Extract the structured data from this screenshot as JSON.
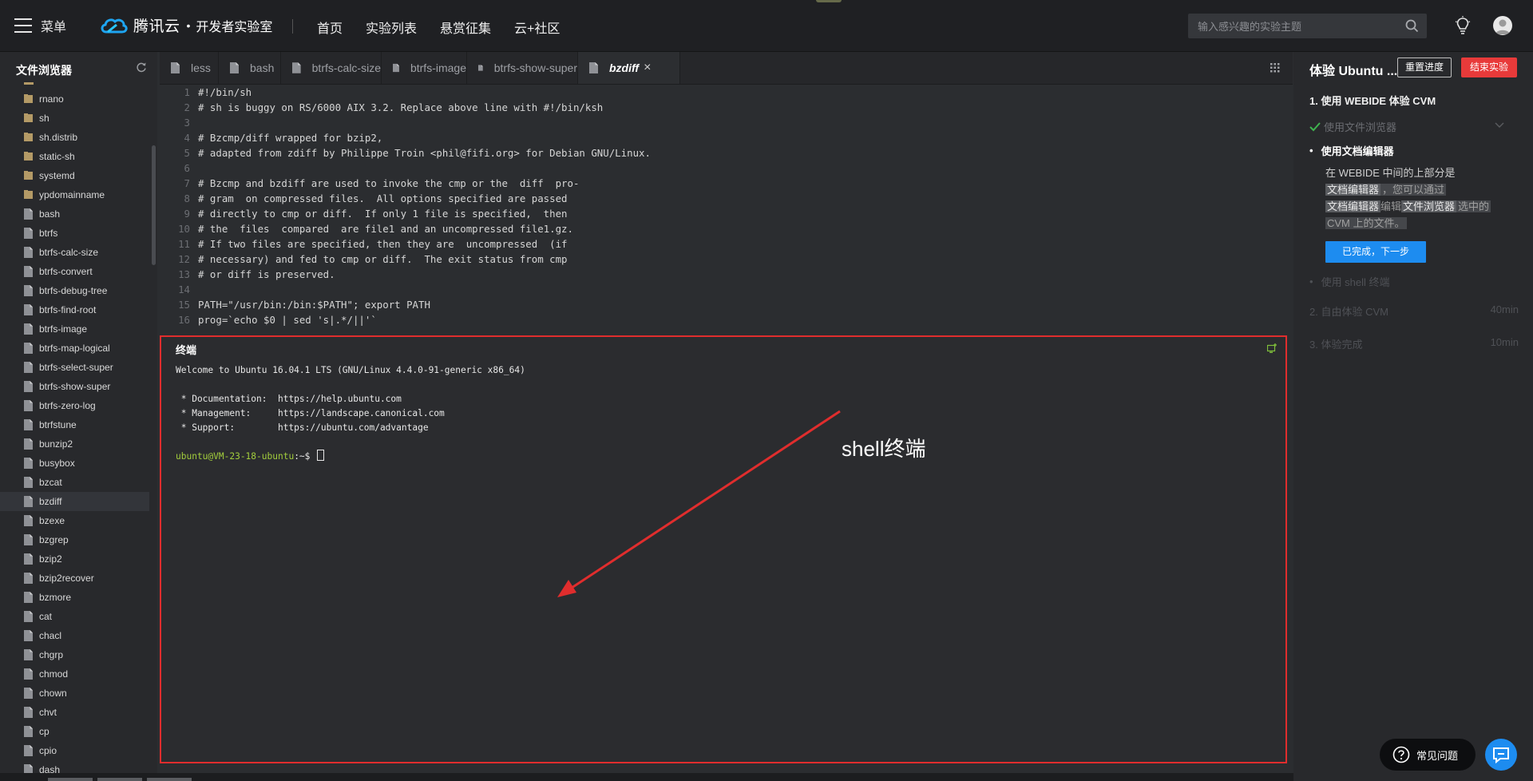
{
  "topbar": {
    "menu_label": "菜单",
    "brand": "腾讯云",
    "brand_dot": "•",
    "brand_sub": "开发者实验室",
    "nav": [
      "首页",
      "实验列表",
      "悬赏征集",
      "云+社区"
    ],
    "search_placeholder": "输入感兴趣的实验主题"
  },
  "explorer": {
    "title": "文件浏览器",
    "items": [
      {
        "name": "rnano",
        "type": "folder"
      },
      {
        "name": "sh",
        "type": "folder"
      },
      {
        "name": "sh.distrib",
        "type": "folder"
      },
      {
        "name": "static-sh",
        "type": "folder"
      },
      {
        "name": "systemd",
        "type": "folder"
      },
      {
        "name": "ypdomainname",
        "type": "folder"
      },
      {
        "name": "bash",
        "type": "file"
      },
      {
        "name": "btrfs",
        "type": "file"
      },
      {
        "name": "btrfs-calc-size",
        "type": "file"
      },
      {
        "name": "btrfs-convert",
        "type": "file"
      },
      {
        "name": "btrfs-debug-tree",
        "type": "file"
      },
      {
        "name": "btrfs-find-root",
        "type": "file"
      },
      {
        "name": "btrfs-image",
        "type": "file"
      },
      {
        "name": "btrfs-map-logical",
        "type": "file"
      },
      {
        "name": "btrfs-select-super",
        "type": "file"
      },
      {
        "name": "btrfs-show-super",
        "type": "file"
      },
      {
        "name": "btrfs-zero-log",
        "type": "file"
      },
      {
        "name": "btrfstune",
        "type": "file"
      },
      {
        "name": "bunzip2",
        "type": "file"
      },
      {
        "name": "busybox",
        "type": "file"
      },
      {
        "name": "bzcat",
        "type": "file"
      },
      {
        "name": "bzdiff",
        "type": "file",
        "active": true
      },
      {
        "name": "bzexe",
        "type": "file"
      },
      {
        "name": "bzgrep",
        "type": "file"
      },
      {
        "name": "bzip2",
        "type": "file"
      },
      {
        "name": "bzip2recover",
        "type": "file"
      },
      {
        "name": "bzmore",
        "type": "file"
      },
      {
        "name": "cat",
        "type": "file"
      },
      {
        "name": "chacl",
        "type": "file"
      },
      {
        "name": "chgrp",
        "type": "file"
      },
      {
        "name": "chmod",
        "type": "file"
      },
      {
        "name": "chown",
        "type": "file"
      },
      {
        "name": "chvt",
        "type": "file"
      },
      {
        "name": "cp",
        "type": "file"
      },
      {
        "name": "cpio",
        "type": "file"
      },
      {
        "name": "dash",
        "type": "file"
      }
    ]
  },
  "tabs": [
    {
      "label": "less",
      "active": false
    },
    {
      "label": "bash",
      "active": false
    },
    {
      "label": "btrfs-calc-size",
      "active": false
    },
    {
      "label": "btrfs-image",
      "active": false
    },
    {
      "label": "btrfs-show-super",
      "active": false
    },
    {
      "label": "bzdiff",
      "active": true
    }
  ],
  "tab_close": "×",
  "editor": {
    "lines": [
      {
        "n": "1",
        "text": "#!/bin/sh"
      },
      {
        "n": "2",
        "text": "# sh is buggy on RS/6000 AIX 3.2. Replace above line with #!/bin/ksh"
      },
      {
        "n": "3",
        "text": ""
      },
      {
        "n": "4",
        "text": "# Bzcmp/diff wrapped for bzip2,"
      },
      {
        "n": "5",
        "text": "# adapted from zdiff by Philippe Troin <phil@fifi.org> for Debian GNU/Linux."
      },
      {
        "n": "6",
        "text": ""
      },
      {
        "n": "7",
        "text": "# Bzcmp and bzdiff are used to invoke the cmp or the  diff  pro-"
      },
      {
        "n": "8",
        "text": "# gram  on compressed files.  All options specified are passed"
      },
      {
        "n": "9",
        "text": "# directly to cmp or diff.  If only 1 file is specified,  then"
      },
      {
        "n": "10",
        "text": "# the  files  compared  are file1 and an uncompressed file1.gz."
      },
      {
        "n": "11",
        "text": "# If two files are specified, then they are  uncompressed  (if"
      },
      {
        "n": "12",
        "text": "# necessary) and fed to cmp or diff.  The exit status from cmp"
      },
      {
        "n": "13",
        "text": "# or diff is preserved."
      },
      {
        "n": "14",
        "text": ""
      },
      {
        "n": "15",
        "text": "PATH=\"/usr/bin:/bin:$PATH\"; export PATH"
      },
      {
        "n": "16",
        "text": "prog=`echo $0 | sed 's|.*/||'`"
      }
    ]
  },
  "terminal": {
    "title": "终端",
    "lines": [
      "Welcome to Ubuntu 16.04.1 LTS (GNU/Linux 4.4.0-91-generic x86_64)",
      "",
      " * Documentation:  https://help.ubuntu.com",
      " * Management:     https://landscape.canonical.com",
      " * Support:        https://ubuntu.com/advantage",
      ""
    ],
    "prompt_user": "ubuntu@VM-23-18-ubuntu",
    "prompt_rest": ":~$ ",
    "annotation": "shell终端",
    "annotation_color": "#e02d2d"
  },
  "right_panel": {
    "title": "体验 Ubuntu ...",
    "reset_label": "重置进度",
    "end_label": "结束实验",
    "step1_title": "1. 使用 WEBIDE 体验 CVM",
    "sub_done": "使用文件浏览器",
    "sub_current": "使用文档编辑器",
    "desc_part1": "在 WEBIDE 中间的上部分是",
    "desc_hl1": "文档编辑器",
    "desc_part2": "，您可以通过",
    "desc_hl2": "文档编辑器",
    "desc_part3": "编辑",
    "desc_hl3": "文件浏览器",
    "desc_part4": "选中的",
    "desc_part5": "CVM 上的文件。",
    "next_label": "已完成，下一步",
    "sub_todo": "使用 shell 终端",
    "step2": "2. 自由体验 CVM",
    "step2_dur": "40min",
    "step3": "3. 体验完成",
    "step3_dur": "10min"
  },
  "faq_label": "常见问题",
  "colors": {
    "accent": "#1d8cf0",
    "danger": "#e83a3a",
    "highlight_border": "#e02d2d",
    "prompt": "#a2cd3c"
  }
}
